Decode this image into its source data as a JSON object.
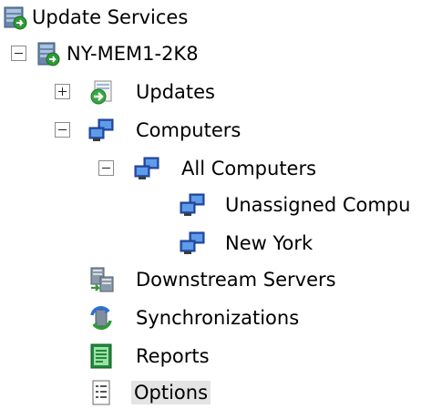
{
  "tree": {
    "root": {
      "label": "Update Services",
      "icon": "update-services-icon"
    },
    "server": {
      "label": "NY-MEM1-2K8",
      "icon": "server-icon",
      "expander": "-"
    },
    "updates": {
      "label": "Updates",
      "icon": "updates-icon",
      "expander": "+"
    },
    "computers": {
      "label": "Computers",
      "icon": "computers-icon",
      "expander": "-"
    },
    "all_computers": {
      "label": "All Computers",
      "icon": "computer-group-icon",
      "expander": "-"
    },
    "unassigned": {
      "label": "Unassigned Compu",
      "icon": "computer-group-icon"
    },
    "new_york": {
      "label": "New York",
      "icon": "computer-group-icon"
    },
    "downstream": {
      "label": "Downstream Servers",
      "icon": "downstream-servers-icon"
    },
    "sync": {
      "label": "Synchronizations",
      "icon": "synchronizations-icon"
    },
    "reports": {
      "label": "Reports",
      "icon": "reports-icon"
    },
    "options": {
      "label": "Options",
      "icon": "options-icon",
      "selected": true
    }
  }
}
